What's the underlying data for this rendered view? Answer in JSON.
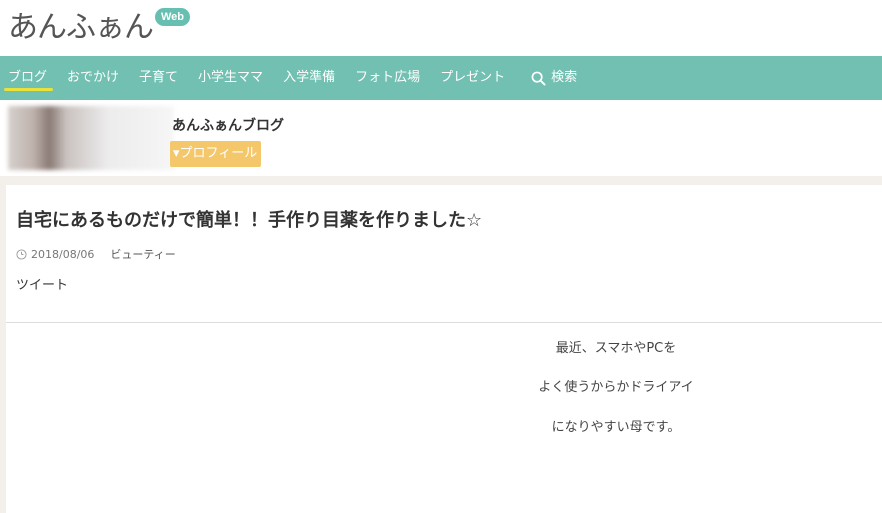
{
  "header": {
    "logo_text": "あんふぁん",
    "logo_badge": "Web"
  },
  "nav": {
    "items": [
      {
        "label": "ブログ"
      },
      {
        "label": "おでかけ"
      },
      {
        "label": "子育て"
      },
      {
        "label": "小学生ママ"
      },
      {
        "label": "入学準備"
      },
      {
        "label": "フォト広場"
      },
      {
        "label": "プレゼント"
      }
    ],
    "search_label": "検索",
    "active_index": 0
  },
  "author": {
    "blog_name": "あんふぁんブログ",
    "profile_button": "▾プロフィール"
  },
  "post": {
    "title": "自宅にあるものだけで簡単！！手作り目薬を作りました☆",
    "date": "2018/08/06",
    "category": "ビューティー",
    "tweet_label": "ツイート",
    "paragraphs": [
      "最近、スマホやPCを",
      "よく使うからかドライアイ",
      "になりやすい母です。"
    ]
  },
  "colors": {
    "nav_bg": "#72c0b1",
    "active_underline": "#e8e23a",
    "profile_button_bg": "#f4c76a",
    "logo_badge_bg": "#66bfb1",
    "content_band_bg": "#f3efea"
  }
}
